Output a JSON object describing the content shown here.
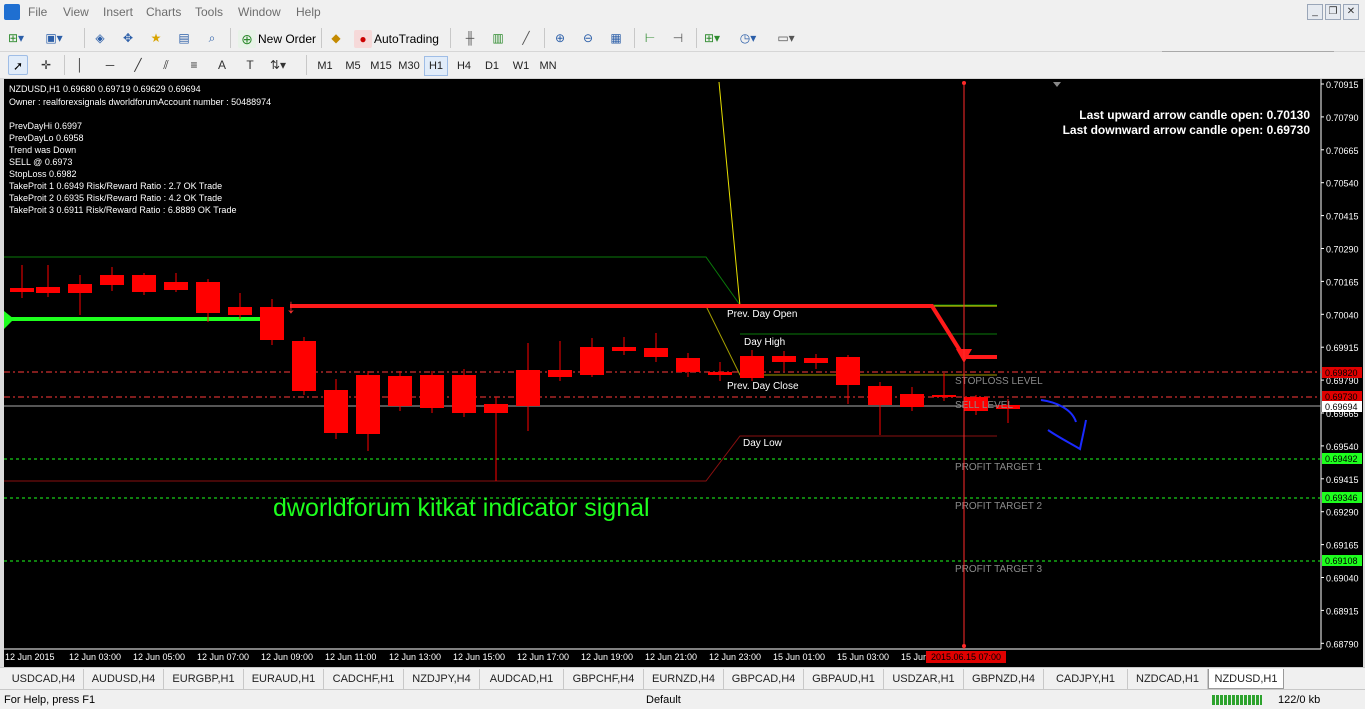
{
  "menu": [
    "File",
    "View",
    "Insert",
    "Charts",
    "Tools",
    "Window",
    "Help"
  ],
  "toolbar": {
    "new_order_label": "New Order",
    "autotrading_label": "AutoTrading"
  },
  "timeframes": [
    "M1",
    "M5",
    "M15",
    "M30",
    "H1",
    "H4",
    "D1",
    "W1",
    "MN"
  ],
  "active_timeframe": "H1",
  "chart": {
    "header": "NZDUSD,H1  0.69680 0.69719 0.69629 0.69694",
    "info_lines": [
      "Owner : realforexsignals dworldforumAccount number : 50488974",
      "",
      "PrevDayHi 0.6997",
      "PrevDayLo 0.6958",
      "Trend was Down",
      "SELL @ 0.6973",
      "StopLoss 0.6982",
      "TakeProit 1 0.6949 Risk/Reward Ratio : 2.7 OK Trade",
      "TakeProit 2 0.6935 Risk/Reward Ratio : 4.2 OK Trade",
      "TakeProit 3 0.6911 Risk/Reward Ratio : 6.8889 OK Trade"
    ],
    "right_info": [
      "Last upward arrow candle open: 0.70130",
      "Last downward arrow candle open: 0.69730"
    ],
    "level_labels": {
      "day_open": "Prev. Day Open",
      "day_high": "Day High",
      "day_close": "Prev. Day Close",
      "day_low": "Day Low",
      "stoploss": "STOPLOSS LEVEL",
      "sell": "SELL LEVEL",
      "pt1": "PROFIT TARGET 1",
      "pt2": "PROFIT TARGET 2",
      "pt3": "PROFIT TARGET 3"
    },
    "watermark": "dworldforum kitkat indicator signal",
    "price_ticks": [
      "0.70915",
      "0.70790",
      "0.70665",
      "0.70540",
      "0.70415",
      "0.70290",
      "0.70165",
      "0.70040",
      "0.69915",
      "0.69790",
      "0.69665",
      "0.69540",
      "0.69415",
      "0.69290",
      "0.69165",
      "0.69040",
      "0.68915",
      "0.68790"
    ],
    "price_badges": {
      "stoploss": "0.69820",
      "sell": "0.69730",
      "current": "0.69694",
      "pt1": "0.69492",
      "pt2": "0.69346",
      "pt3": "0.69108"
    },
    "time_ticks": [
      "12 Jun 2015",
      "12 Jun 03:00",
      "12 Jun 05:00",
      "12 Jun 07:00",
      "12 Jun 09:00",
      "12 Jun 11:00",
      "12 Jun 13:00",
      "12 Jun 15:00",
      "12 Jun 17:00",
      "12 Jun 19:00",
      "12 Jun 21:00",
      "12 Jun 23:00",
      "15 Jun 01:00",
      "15 Jun 03:00",
      "15 Jun 05:00"
    ],
    "crosshair_time": "2015.06.15 07:00",
    "colors": {
      "bull": "#00ff00",
      "bear": "#ff0000",
      "background": "#000000",
      "grid_text": "#ffffff"
    }
  },
  "tabs": [
    "USDCAD,H4",
    "AUDUSD,H4",
    "EURGBP,H1",
    "EURAUD,H1",
    "CADCHF,H1",
    "NZDJPY,H4",
    "AUDCAD,H1",
    "GBPCHF,H4",
    "EURNZD,H4",
    "GBPCAD,H4",
    "GBPAUD,H1",
    "USDZAR,H1",
    "GBPNZD,H4",
    "CADJPY,H1",
    "NZDCAD,H1",
    "NZDUSD,H1"
  ],
  "active_tab": "NZDUSD,H1",
  "status": {
    "help": "For Help, press F1",
    "profile": "Default",
    "traffic": "122/0 kb"
  }
}
